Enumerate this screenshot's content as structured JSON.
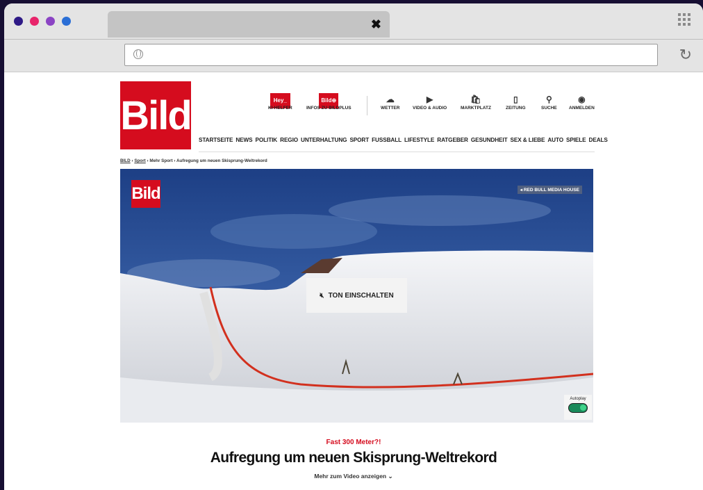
{
  "browser": {
    "tab_close_glyph": "✖",
    "address_value": "",
    "reload_glyph": "↻",
    "dot_colors": [
      "#2e1a86",
      "#e8256b",
      "#8b44c4",
      "#2b6fd6"
    ]
  },
  "site": {
    "logo_text": "Bild",
    "top_icons": [
      {
        "label": "KI-HELFER",
        "icon": "hey-badge",
        "badge": "Hey_"
      },
      {
        "label": "INFOS ZU BILDPLUS",
        "icon": "bildplus-badge",
        "badge": "Bild⊕"
      },
      {
        "label": "WETTER",
        "icon": "weather-icon",
        "glyph": "☁"
      },
      {
        "label": "VIDEO & AUDIO",
        "icon": "video-icon",
        "glyph": "▶"
      },
      {
        "label": "MARKTPLATZ",
        "icon": "shopping-bag-icon",
        "glyph": "🛍"
      },
      {
        "label": "ZEITUNG",
        "icon": "newspaper-icon",
        "glyph": "▯"
      },
      {
        "label": "SUCHE",
        "icon": "search-icon",
        "glyph": "⚲"
      },
      {
        "label": "ANMELDEN",
        "icon": "user-icon",
        "glyph": "◉"
      }
    ],
    "nav": [
      "STARTSEITE",
      "NEWS",
      "POLITIK",
      "REGIO",
      "UNTERHALTUNG",
      "SPORT",
      "FUSSBALL",
      "LIFESTYLE",
      "RATGEBER",
      "GESUNDHEIT",
      "SEX & LIEBE",
      "AUTO",
      "SPIELE",
      "DEALS"
    ],
    "breadcrumb": {
      "items": [
        "BILD",
        "Sport",
        "Mehr Sport",
        "Aufregung um neuen Skisprung-Weltrekord"
      ],
      "separator": "›"
    }
  },
  "video": {
    "logo_text": "Bild",
    "credit": "◂ RED BULL MEDIA HOUSE",
    "sound_button": "TON EINSCHALTEN",
    "autoplay_label": "Autoplay",
    "autoplay_on": true
  },
  "article": {
    "kicker": "Fast 300 Meter?!",
    "headline": "Aufregung um neuen Skisprung-Weltrekord",
    "more": "Mehr zum Video anzeigen ⌄"
  },
  "colors": {
    "brand_red": "#d50c1e",
    "background": "#170f33",
    "cursor": "#e84a9e"
  }
}
